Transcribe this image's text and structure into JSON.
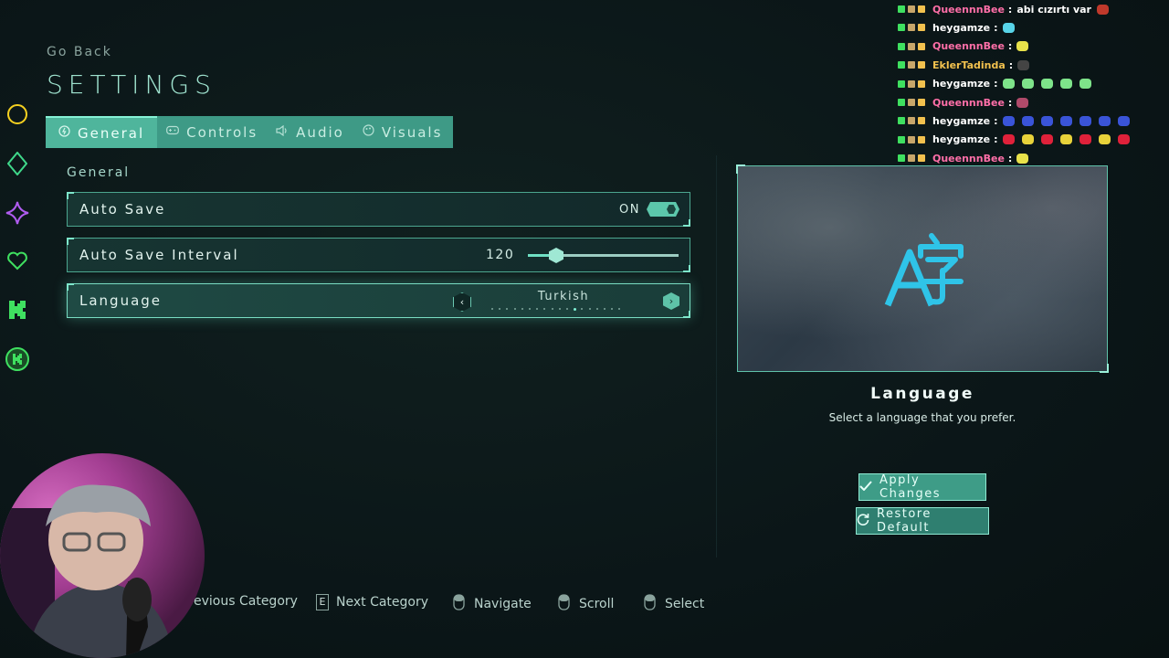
{
  "header": {
    "back_label": "Go Back",
    "title": "SETTINGS"
  },
  "tabs": [
    {
      "label": "General",
      "icon": "gear-icon",
      "active": true
    },
    {
      "label": "Controls",
      "icon": "gamepad-icon",
      "active": false
    },
    {
      "label": "Audio",
      "icon": "speaker-icon",
      "active": false
    },
    {
      "label": "Visuals",
      "icon": "palette-icon",
      "active": false
    }
  ],
  "section": {
    "title": "General",
    "settings": [
      {
        "label": "Auto Save",
        "type": "toggle",
        "value_text": "ON",
        "value": true
      },
      {
        "label": "Auto Save Interval",
        "type": "slider",
        "value_text": "120",
        "fraction": 0.14
      },
      {
        "label": "Language",
        "type": "selector",
        "value_text": "Turkish",
        "option_count": 18,
        "option_index": 11
      }
    ]
  },
  "info_panel": {
    "icon": "translate-icon",
    "title": "Language",
    "description": "Select a language that you prefer."
  },
  "buttons": {
    "apply": {
      "label": "Apply Changes",
      "icon": "check-icon"
    },
    "restore": {
      "label": "Restore Default",
      "icon": "refresh-icon"
    }
  },
  "hints": [
    {
      "label": "evious Category",
      "icon": "key-q"
    },
    {
      "label": "Next Category",
      "key": "E",
      "icon": "key-e"
    },
    {
      "label": "Navigate",
      "icon": "mouse-icon"
    },
    {
      "label": "Scroll",
      "icon": "mouse-wheel-icon"
    },
    {
      "label": "Select",
      "icon": "mouse-click-icon"
    }
  ],
  "side_icons": [
    "circle-icon",
    "diamond-icon",
    "sparkle-icon",
    "heart-icon",
    "kick-icon",
    "kick-badge-icon"
  ],
  "chat": [
    {
      "user": "QueennnBee",
      "color": "#ff6fa8",
      "message": "abi cızırtı var",
      "emotes": [
        "#c0392b"
      ]
    },
    {
      "user": "heygamze",
      "color": "#ffffff",
      "message": "",
      "emotes": [
        "#58d4e8"
      ]
    },
    {
      "user": "QueennnBee",
      "color": "#ff6fa8",
      "message": "",
      "emotes": [
        "#e8e24a"
      ]
    },
    {
      "user": "EklerTadinda",
      "color": "#f2c14e",
      "message": "",
      "emotes": [
        "#444444"
      ]
    },
    {
      "user": "heygamze",
      "color": "#ffffff",
      "message": "",
      "emotes": [
        "#7ee38a",
        "#7ee38a",
        "#7ee38a",
        "#7ee38a",
        "#7ee38a"
      ]
    },
    {
      "user": "QueennnBee",
      "color": "#ff6fa8",
      "message": "",
      "emotes": [
        "#b04a6a"
      ]
    },
    {
      "user": "heygamze",
      "color": "#ffffff",
      "message": "",
      "emotes": [
        "#3a54d8",
        "#3a54d8",
        "#3a54d8",
        "#3a54d8",
        "#3a54d8",
        "#3a54d8",
        "#3a54d8"
      ]
    },
    {
      "user": "heygamze",
      "color": "#ffffff",
      "message": "",
      "emotes": [
        "#e0213a",
        "#e8d23a",
        "#e0213a",
        "#e8d23a",
        "#e0213a",
        "#e8d23a",
        "#e0213a"
      ]
    },
    {
      "user": "QueennnBee",
      "color": "#ff6fa8",
      "message": "",
      "emotes": [
        "#e8e24a"
      ]
    }
  ],
  "colors": {
    "accent": "#4fb59c",
    "accent_light": "#86f2d6",
    "background": "#0b1719"
  }
}
